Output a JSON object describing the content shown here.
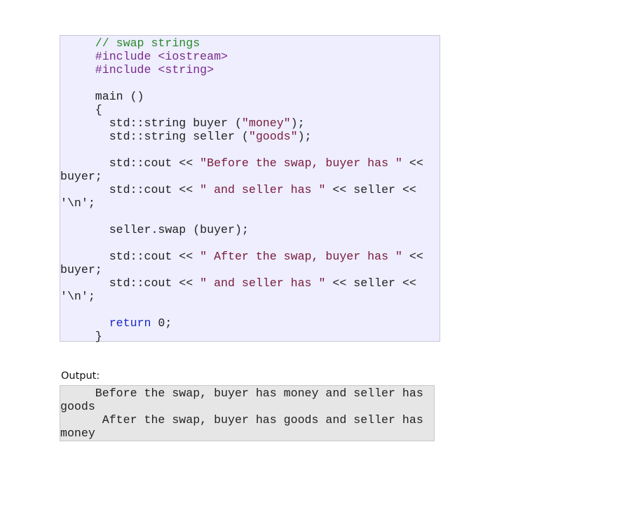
{
  "code_block": {
    "lines": [
      [
        {
          "t": "     "
        },
        {
          "t": "// swap strings",
          "c": "cm"
        }
      ],
      [
        {
          "t": "     "
        },
        {
          "t": "#include <iostream>",
          "c": "pp"
        }
      ],
      [
        {
          "t": "     "
        },
        {
          "t": "#include <string>",
          "c": "pp"
        }
      ],
      [
        {
          "t": ""
        }
      ],
      [
        {
          "t": "     main ()"
        }
      ],
      [
        {
          "t": "     {"
        }
      ],
      [
        {
          "t": "       std::string buyer ("
        },
        {
          "t": "\"money\"",
          "c": "str"
        },
        {
          "t": ");"
        }
      ],
      [
        {
          "t": "       std::string seller ("
        },
        {
          "t": "\"goods\"",
          "c": "str"
        },
        {
          "t": ");"
        }
      ],
      [
        {
          "t": ""
        }
      ],
      [
        {
          "t": "       std::cout << "
        },
        {
          "t": "\"Before the swap, buyer has \"",
          "c": "str"
        },
        {
          "t": " <<"
        }
      ],
      [
        {
          "t": "buyer;"
        }
      ],
      [
        {
          "t": "       std::cout << "
        },
        {
          "t": "\" and seller has \"",
          "c": "str"
        },
        {
          "t": " << seller <<"
        }
      ],
      [
        {
          "t": "'\\n';"
        }
      ],
      [
        {
          "t": ""
        }
      ],
      [
        {
          "t": "       seller.swap (buyer);"
        }
      ],
      [
        {
          "t": ""
        }
      ],
      [
        {
          "t": "       std::cout << "
        },
        {
          "t": "\" After the swap, buyer has \"",
          "c": "str"
        },
        {
          "t": " <<"
        }
      ],
      [
        {
          "t": "buyer;"
        }
      ],
      [
        {
          "t": "       std::cout << "
        },
        {
          "t": "\" and seller has \"",
          "c": "str"
        },
        {
          "t": " << seller <<"
        }
      ],
      [
        {
          "t": "'\\n';"
        }
      ],
      [
        {
          "t": ""
        }
      ],
      [
        {
          "t": "       "
        },
        {
          "t": "return",
          "c": "kw"
        },
        {
          "t": " 0;"
        }
      ],
      [
        {
          "t": "     }"
        }
      ]
    ]
  },
  "output_section": {
    "label": "Output:",
    "lines": [
      "     Before the swap, buyer has money and seller has",
      "goods",
      "      After the swap, buyer has goods and seller has",
      "money"
    ]
  },
  "colors": {
    "code_background": "#eeeeff",
    "code_border": "#c8c8d8",
    "comment": "#2a8a2a",
    "preprocessor": "#7a2a8a",
    "string": "#7a1a3a",
    "keyword": "#1a2ac8",
    "output_background": "#e6e6e6"
  }
}
